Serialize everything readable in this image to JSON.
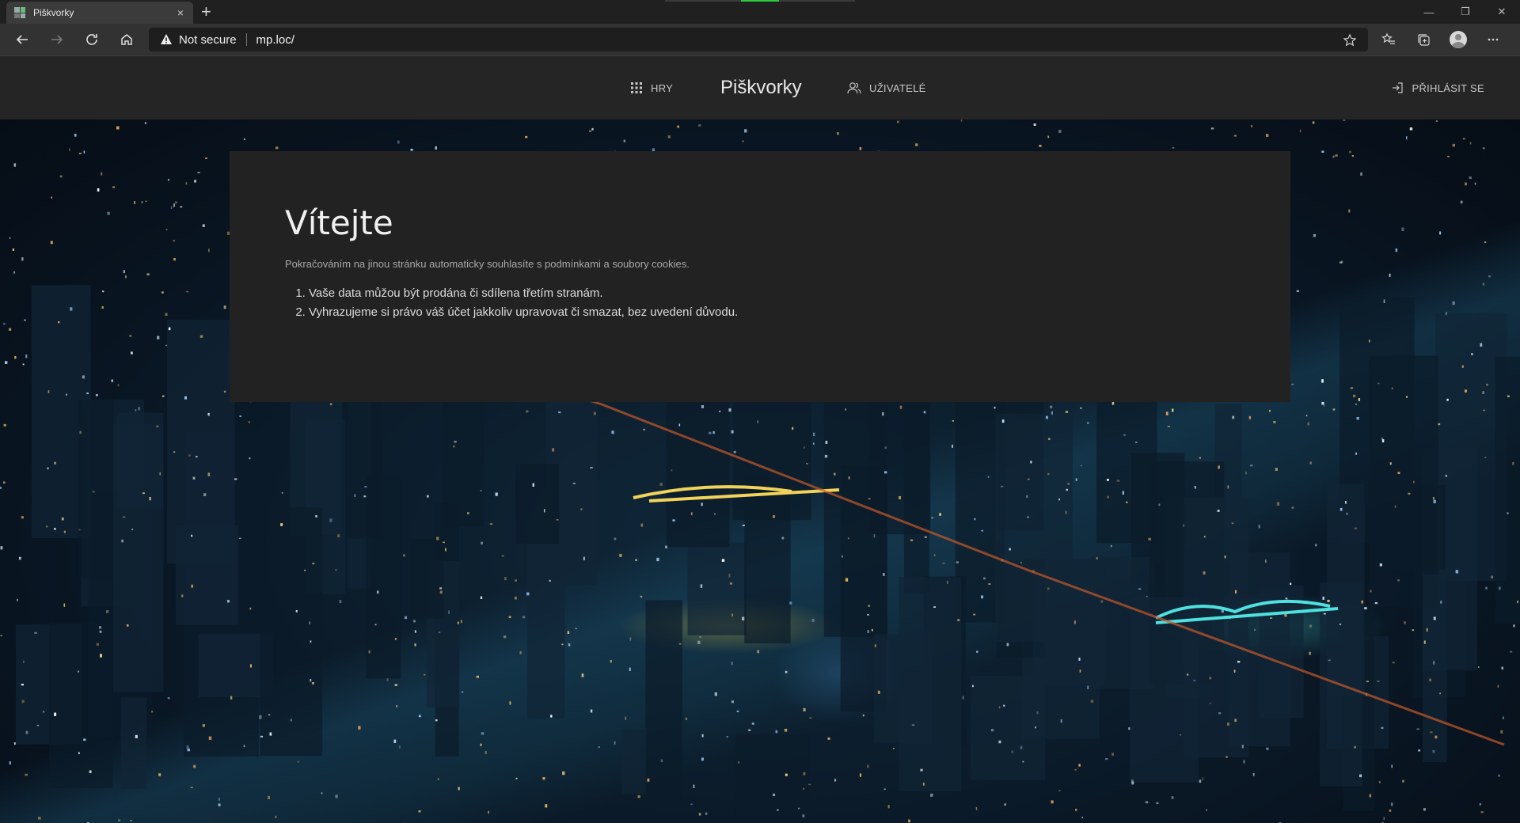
{
  "browser": {
    "tab_title": "Piškvorky",
    "tab_close": "×",
    "new_tab": "+",
    "security_label": "Not secure",
    "url": "mp.loc/",
    "window_controls": [
      "—",
      "❐",
      "✕"
    ]
  },
  "site": {
    "brand": "Piškvorky",
    "nav_games": "HRY",
    "nav_users": "UŽIVATELÉ",
    "nav_login": "PŘIHLÁSIT SE"
  },
  "welcome": {
    "heading": "Vítejte",
    "notice": "Pokračováním na jinou stránku automaticky souhlasíte s podmínkami a soubory cookies.",
    "terms": [
      "Vaše data můžou být prodána či sdílena třetím stranám.",
      "Vyhrazujeme si právo váš účet jakkoliv upravovat či smazat, bez uvedení důvodu."
    ]
  },
  "colors": {
    "header_bg": "#252525",
    "panel_bg": "#222222",
    "chrome_bg": "#202020",
    "toolbar_bg": "#323232"
  },
  "icons": {
    "games": "grid-icon",
    "users": "users-icon",
    "login": "login-icon"
  }
}
